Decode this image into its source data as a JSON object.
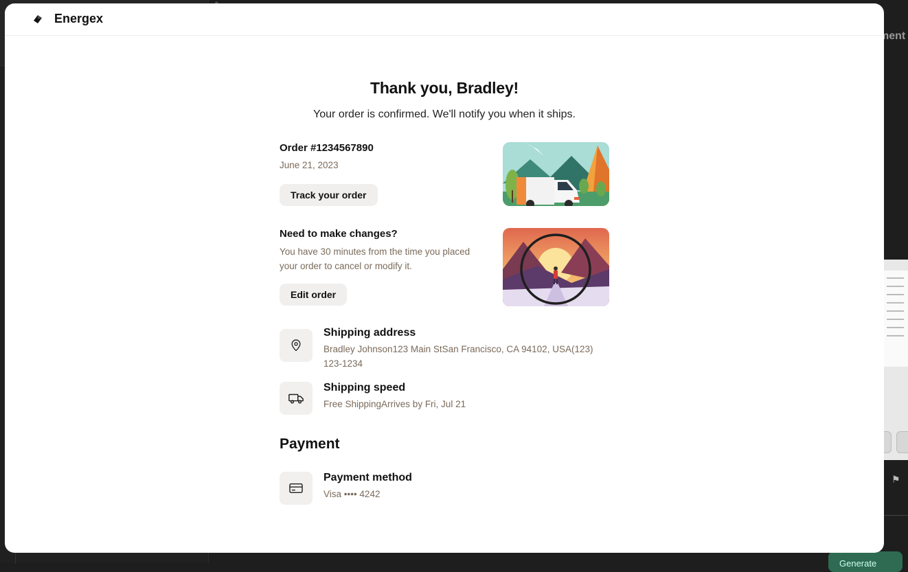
{
  "brand": {
    "name": "Energex"
  },
  "confirmation": {
    "title": "Thank you, Bradley!",
    "subtitle": "Your order is confirmed. We'll notify you when it ships."
  },
  "order": {
    "number_label": "Order #1234567890",
    "date": "June 21, 2023",
    "track_button": "Track your order",
    "image_icon": "delivery-van-illustration"
  },
  "changes": {
    "title": "Need to make changes?",
    "description": "You have 30 minutes from the time you placed your order to cancel or modify it.",
    "edit_button": "Edit order",
    "image_icon": "magnifier-landscape-illustration"
  },
  "shipping_address": {
    "title": "Shipping address",
    "value": "Bradley Johnson123 Main StSan Francisco, CA 94102, USA(123) 123-1234",
    "icon": "map-pin-icon"
  },
  "shipping_speed": {
    "title": "Shipping speed",
    "value": "Free ShippingArrives by Fri, Jul 21",
    "icon": "truck-icon"
  },
  "payment": {
    "heading": "Payment",
    "method_title": "Payment method",
    "method_value": "Visa •••• 4242",
    "icon": "credit-card-icon"
  },
  "background": {
    "right_text": "ment",
    "generate_label": "Generate"
  },
  "colors": {
    "muted_text": "#7a6a5a",
    "button_bg": "#f0efed",
    "icon_box_bg": "#f1f0ee",
    "backdrop": "#1e1e1e"
  }
}
